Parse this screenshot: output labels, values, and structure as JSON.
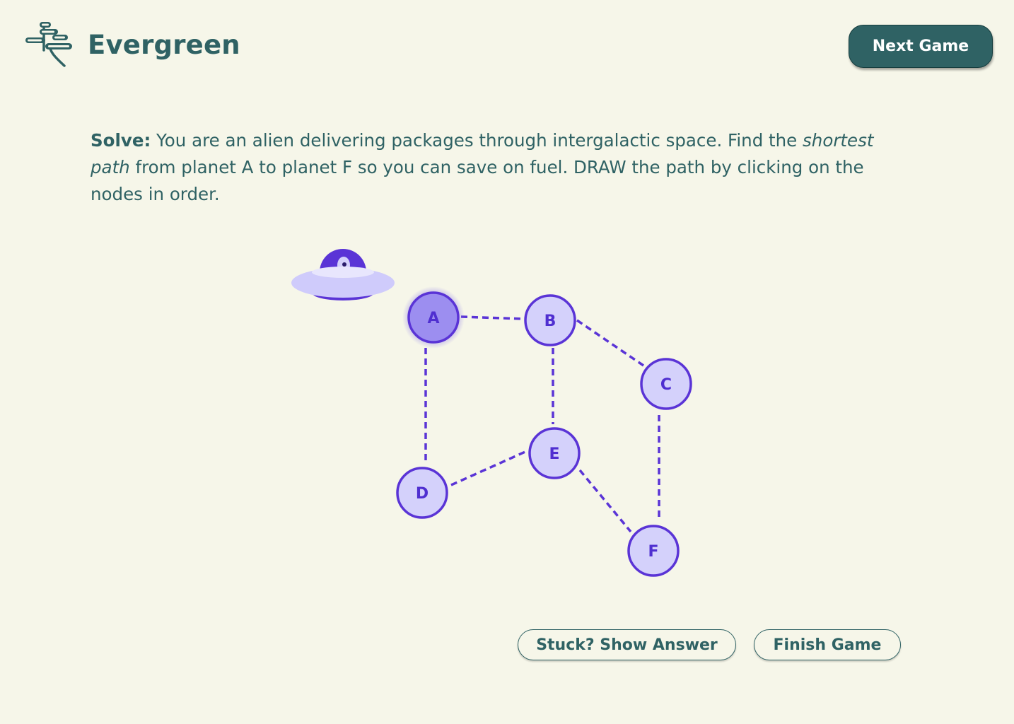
{
  "app": {
    "name": "Evergreen",
    "logo_icon": "bonsai-tree-icon"
  },
  "header": {
    "next_game_label": "Next Game"
  },
  "prompt": {
    "lead": "Solve:",
    "part1": " You are an alien delivering packages through intergalactic space. Find the ",
    "emphasis": "shortest path",
    "part2": " from planet A to planet F so you can save on fuel. DRAW the path by clicking on the nodes in order."
  },
  "graph": {
    "nodes": [
      {
        "id": "A",
        "label": "A",
        "selected": true
      },
      {
        "id": "B",
        "label": "B",
        "selected": false
      },
      {
        "id": "C",
        "label": "C",
        "selected": false
      },
      {
        "id": "D",
        "label": "D",
        "selected": false
      },
      {
        "id": "E",
        "label": "E",
        "selected": false
      },
      {
        "id": "F",
        "label": "F",
        "selected": false
      }
    ],
    "edges": [
      [
        "A",
        "B"
      ],
      [
        "A",
        "D"
      ],
      [
        "B",
        "C"
      ],
      [
        "B",
        "E"
      ],
      [
        "C",
        "F"
      ],
      [
        "D",
        "E"
      ],
      [
        "E",
        "F"
      ]
    ],
    "alien_icon": "ufo-alien-icon",
    "colors": {
      "node_fill": "#d4d1fb",
      "node_stroke": "#5a34d6",
      "selected_fill": "#9c8ef0",
      "edge": "#5a34d6",
      "text": "#2f6264",
      "background": "#f6f6e9"
    }
  },
  "actions": {
    "show_answer_label": "Stuck? Show Answer",
    "finish_label": "Finish Game"
  }
}
